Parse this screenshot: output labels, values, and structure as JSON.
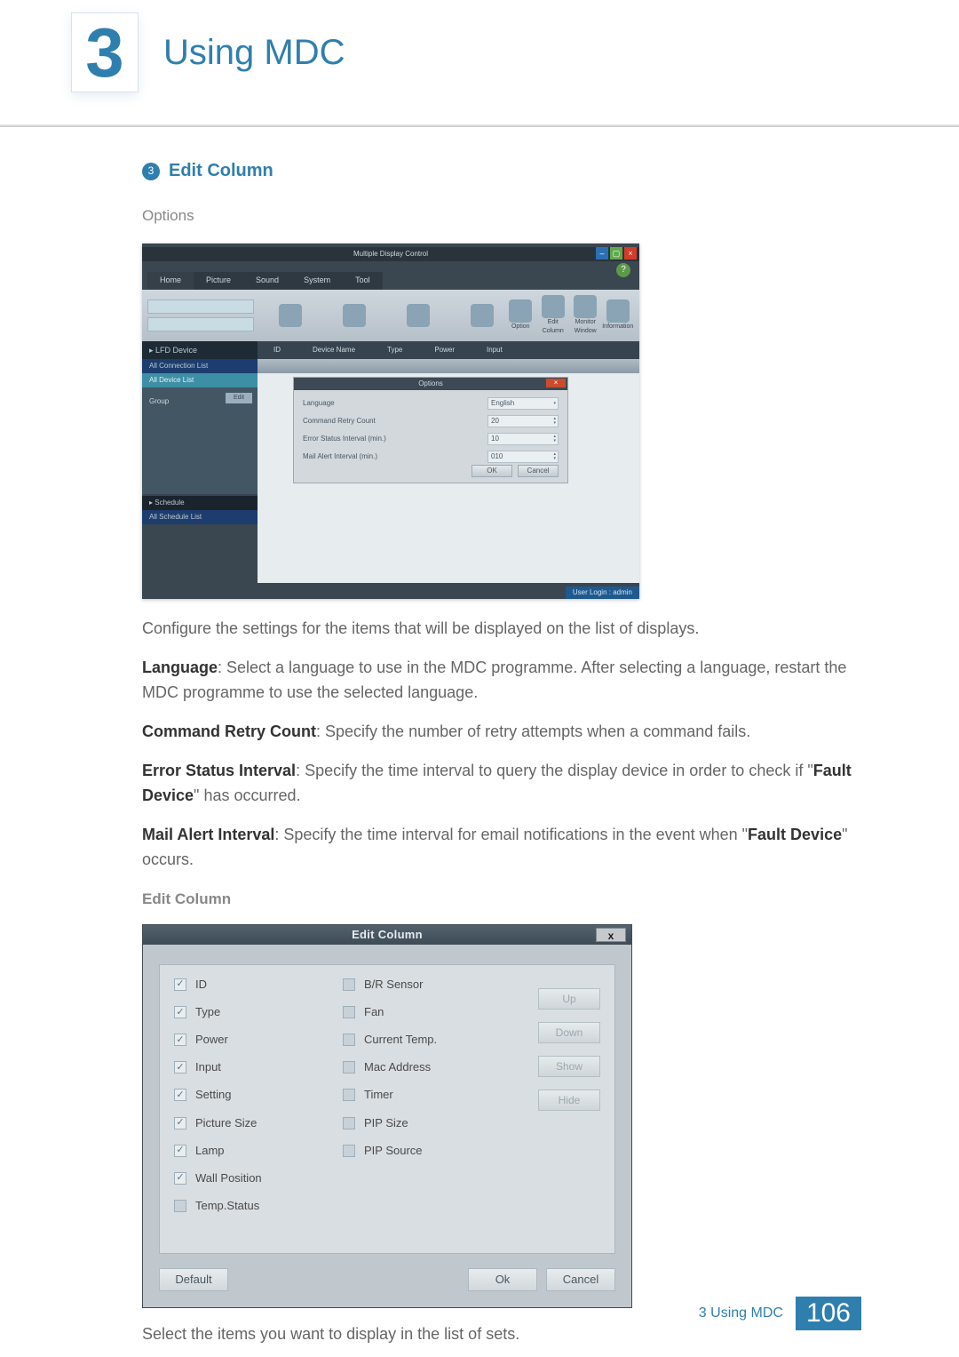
{
  "header": {
    "chapter_number": "3",
    "chapter_title": "Using MDC"
  },
  "section": {
    "bullet_number": "3",
    "title": "Edit Column",
    "options_label": "Options"
  },
  "options_dialog": {
    "window_title": "Multiple Display Control",
    "menu": [
      "Home",
      "Picture",
      "Sound",
      "System",
      "Tool"
    ],
    "toolbar_labels": [
      "Option",
      "Edit Column",
      "Monitor Window",
      "Information"
    ],
    "left_headers": {
      "lfd_device": "▸ LFD Device",
      "all_conn": "All Connection List",
      "all_dev": "All Device List",
      "group": "Group",
      "edit": "Edit",
      "schedule": "▸ Schedule",
      "all_sched": "All Schedule List"
    },
    "table_headers": [
      "ID",
      "Device Name",
      "Type",
      "Power",
      "Input"
    ],
    "mid_tabs": [
      "",
      ""
    ],
    "dialog_title": "Options",
    "rows": [
      {
        "label": "Language",
        "value": "English"
      },
      {
        "label": "Command Retry Count",
        "value": "20"
      },
      {
        "label": "Error Status Interval (min.)",
        "value": "10"
      },
      {
        "label": "Mail Alert Interval (min.)",
        "value": "010"
      }
    ],
    "ok": "OK",
    "cancel": "Cancel",
    "footer": "User Login : admin"
  },
  "body": {
    "p1": "Configure the settings for the items that will be displayed on the list of displays.",
    "p2a": "Language",
    "p2b": ": Select a language to use in the MDC programme. After selecting a language, restart the MDC programme to use the selected language.",
    "p3a": "Command Retry Count",
    "p3b": ": Specify the number of retry attempts when a command fails.",
    "p4a": "Error Status Interval",
    "p4b": ": Specify the time interval to query the display device in order to check if \"",
    "p4c": "Fault Device",
    "p4d": "\" has occurred.",
    "p5a": "Mail Alert Interval",
    "p5b": ": Specify the time interval for email notifications in the event when \"",
    "p5c": "Fault Device",
    "p5d": "\" occurs.",
    "edit_column_heading": "Edit Column"
  },
  "edit_column_dialog": {
    "title": "Edit Column",
    "close": "x",
    "left_items": [
      {
        "label": "ID",
        "checked": true
      },
      {
        "label": "Type",
        "checked": true
      },
      {
        "label": "Power",
        "checked": true
      },
      {
        "label": "Input",
        "checked": true
      },
      {
        "label": "Setting",
        "checked": true
      },
      {
        "label": "Picture Size",
        "checked": true
      },
      {
        "label": "Lamp",
        "checked": true
      },
      {
        "label": "Wall Position",
        "checked": true
      },
      {
        "label": "Temp.Status",
        "checked": false
      }
    ],
    "right_items": [
      {
        "label": "B/R Sensor",
        "checked": false
      },
      {
        "label": "Fan",
        "checked": false
      },
      {
        "label": "Current Temp.",
        "checked": false
      },
      {
        "label": "Mac Address",
        "checked": false
      },
      {
        "label": "Timer",
        "checked": false
      },
      {
        "label": "PIP Size",
        "checked": false
      },
      {
        "label": "PIP Source",
        "checked": false
      }
    ],
    "side_buttons": [
      "Up",
      "Down",
      "Show",
      "Hide"
    ],
    "footer_buttons": {
      "default": "Default",
      "ok": "Ok",
      "cancel": "Cancel"
    }
  },
  "closing_para": "Select the items you want to display in the list of sets.",
  "page_footer": {
    "label": "3 Using MDC",
    "page": "106"
  }
}
